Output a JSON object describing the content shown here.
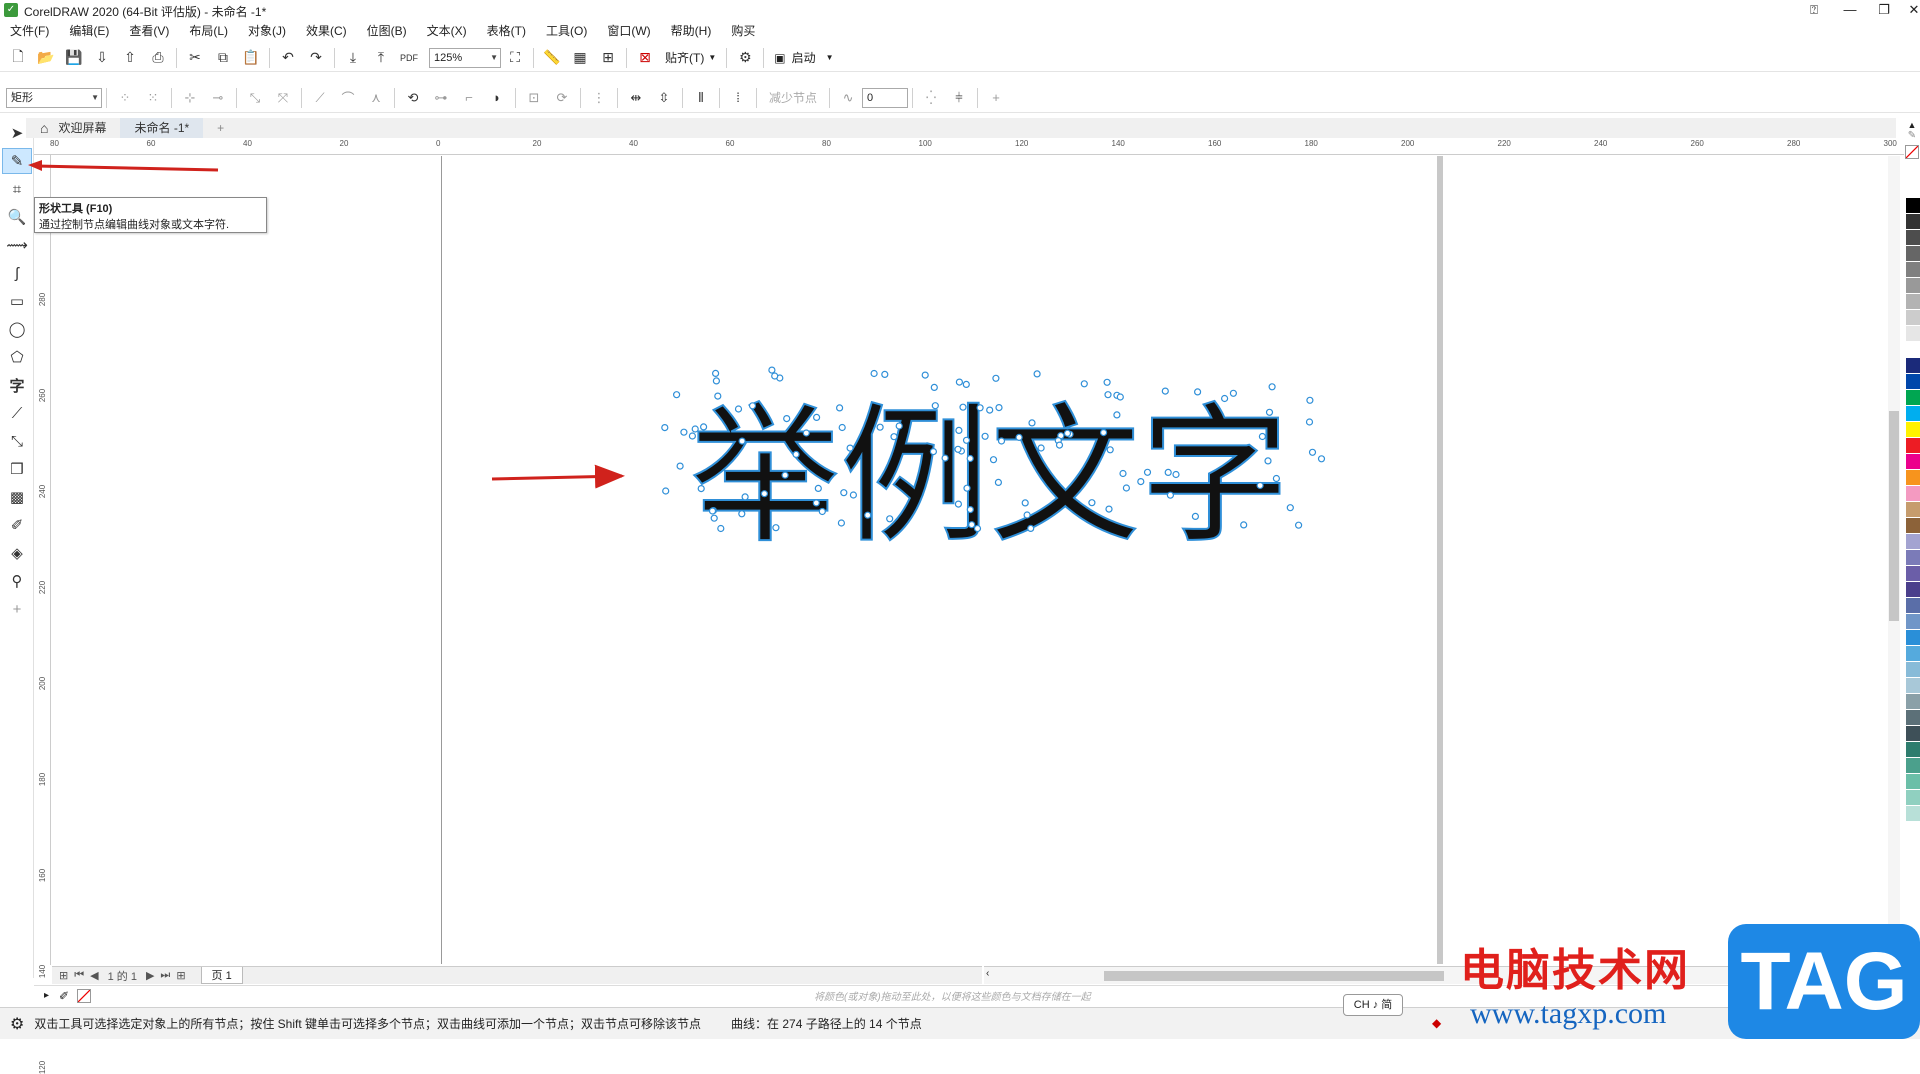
{
  "window": {
    "title": "CorelDRAW 2020 (64-Bit 评估版) - 未命名 -1*",
    "app_icon": "coreldraw-logo-icon"
  },
  "menu": [
    "文件(F)",
    "编辑(E)",
    "查看(V)",
    "布局(L)",
    "对象(J)",
    "效果(C)",
    "位图(B)",
    "文本(X)",
    "表格(T)",
    "工具(O)",
    "窗口(W)",
    "帮助(H)",
    "购买"
  ],
  "toolbar": {
    "zoom_value": "125%",
    "snap_label": "贴齐(T)",
    "launch_label": "启动"
  },
  "property_bar": {
    "shape_type": "矩形",
    "reduce_nodes_label": "减少节点",
    "smoothness_value": "0"
  },
  "tabs": {
    "welcome": "欢迎屏幕",
    "document": "未命名 -1*"
  },
  "tooltip": {
    "title": "形状工具 (F10)",
    "description": "通过控制节点编辑曲线对象或文本字符."
  },
  "canvas": {
    "text": "举例文字",
    "text_color": "#111111",
    "node_color": "#2f8fd8"
  },
  "rulers": {
    "h_ticks": [
      "80",
      "60",
      "40",
      "20",
      "0",
      "20",
      "40",
      "60",
      "80",
      "100",
      "120",
      "140",
      "160",
      "180",
      "200",
      "220",
      "240",
      "260",
      "280",
      "300"
    ],
    "v_ticks": [
      "280",
      "260",
      "240",
      "220",
      "200",
      "180",
      "160",
      "140",
      "120"
    ]
  },
  "page_nav": {
    "counter": "1 的 1",
    "page_tab": "页 1"
  },
  "color_dock_hint": "将颜色(或对象)拖动至此处，以便将这些颜色与文档存储在一起",
  "status": {
    "hint": "双击工具可选择选定对象上的所有节点；按住 Shift 键单击可选择多个节点；双击曲线可添加一个节点；双击节点可移除该节点",
    "object_info": "曲线：在 274 子路径上的 14 个节点"
  },
  "ime_badge": "CH ♪ 简",
  "watermark": {
    "site_name": "电脑技术网",
    "url": "www.tagxp.com",
    "logo": "TAG"
  },
  "palette_colors": [
    "#ffffff",
    "#000000",
    "#333333",
    "#4d4d4d",
    "#666666",
    "#808080",
    "#999999",
    "#b3b3b3",
    "#cccccc",
    "#e6e6e6",
    "#ffffff",
    "#1b2a7a",
    "#0047ab",
    "#00a651",
    "#00aeef",
    "#fff200",
    "#ed1c24",
    "#ec008c",
    "#f7941d",
    "#f49ac1",
    "#c69c6d",
    "#8c6239",
    "#a3a3d1",
    "#7b7bb8",
    "#6b5ea8",
    "#4b3f8c",
    "#5a6ea8",
    "#7096c8",
    "#2a8fd8",
    "#55aadd",
    "#88bbd8",
    "#a8c8d8",
    "#8aa0a8",
    "#5c7078",
    "#3e5058",
    "#2e7d6e",
    "#4ba08c",
    "#6bbfa8",
    "#90d0c0",
    "#b8e0d8"
  ]
}
